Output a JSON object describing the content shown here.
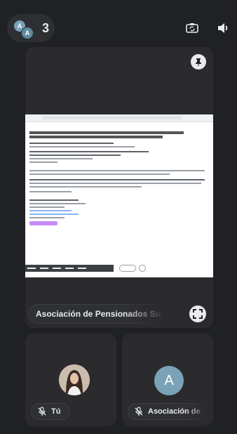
{
  "topbar": {
    "participant_count": "3",
    "participant_avatars": [
      "A",
      "A"
    ],
    "icons": [
      "switch-camera-icon",
      "speaker-icon"
    ]
  },
  "main_tile": {
    "presenter_name": "Asociación de Pensionados Sup",
    "icons": [
      "pin-icon",
      "fullscreen-icon"
    ]
  },
  "tiles": [
    {
      "name": "Tú",
      "avatar": "photo",
      "mic": "muted"
    },
    {
      "name": "Asociación de",
      "avatar_letter": "A",
      "mic": "muted"
    }
  ],
  "colors": {
    "background": "#202124",
    "tile": "#2b2b2d",
    "avatar_blue": "#7aa3b8",
    "text": "#e8eaed"
  }
}
